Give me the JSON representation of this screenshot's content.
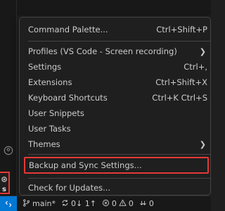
{
  "menu": {
    "items": [
      {
        "label": "Command Palette...",
        "shortcut": "Ctrl+Shift+P"
      },
      {
        "label": "Profiles (VS Code - Screen recording)",
        "submenu": true
      },
      {
        "label": "Settings",
        "shortcut": "Ctrl+,"
      },
      {
        "label": "Extensions",
        "shortcut": "Ctrl+Shift+X"
      },
      {
        "label": "Keyboard Shortcuts",
        "shortcut": "Ctrl+K Ctrl+S"
      },
      {
        "label": "User Snippets"
      },
      {
        "label": "User Tasks"
      },
      {
        "label": "Themes",
        "submenu": true
      },
      {
        "label": "Backup and Sync Settings..."
      },
      {
        "label": "Check for Updates..."
      }
    ]
  },
  "status_bar": {
    "branch": "main*",
    "sync": "0↓ 1↑",
    "errors": "0",
    "warnings": "0",
    "ports": "0"
  },
  "icons": {
    "remote": "remote-icon",
    "branch": "git-branch-icon",
    "sync": "sync-icon",
    "error": "error-icon",
    "warning": "warning-icon",
    "ports": "ports-icon",
    "accounts": "accounts-icon",
    "manage": "gear-icon"
  },
  "colors": {
    "background": "#1f1f1f",
    "highlight_border": "#e53935",
    "remote_accent": "#0078d4",
    "text": "#cccccc"
  }
}
